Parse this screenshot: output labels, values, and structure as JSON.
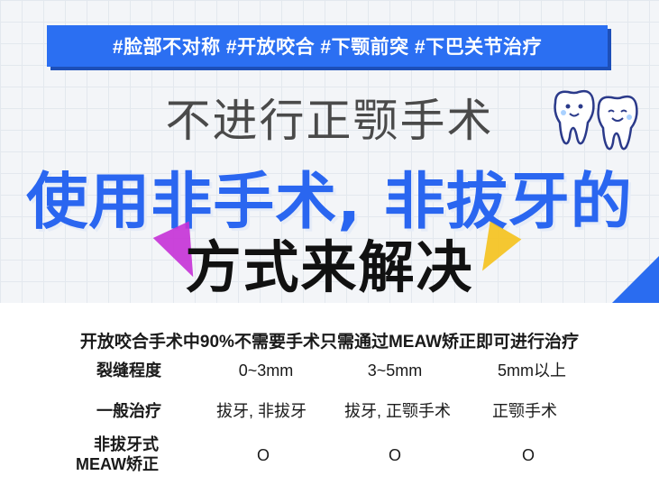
{
  "banner": {
    "tags": "#脸部不对称 #开放咬合 #下颚前突 #下巴关节治疗",
    "line1": "不进行正颚手术",
    "line2": "使用非手术, 非拔牙的",
    "line3": "方式来解决"
  },
  "intro": "开放咬合手术中90%不需要手术只需通过MEAW矫正即可进行治疗",
  "table": {
    "rows": [
      {
        "label": "裂缝程度",
        "c1": "0~3mm",
        "c2": "3~5mm",
        "c3": "5mm以上"
      },
      {
        "label": "一般治疗",
        "c1": "拔牙, 非拔牙",
        "c2": "拔牙, 正颚手术",
        "c3": "正颚手术"
      },
      {
        "label_line1": "非拔牙式",
        "label_line2": "MEAW矫正",
        "c1": "O",
        "c2": "O",
        "c3": "O"
      }
    ]
  },
  "colors": {
    "brand_blue": "#2b6ff2",
    "accent_magenta": "#c531d6",
    "accent_yellow": "#f5c21b"
  },
  "icons": {
    "mascot": "tooth-mascot-icon"
  }
}
